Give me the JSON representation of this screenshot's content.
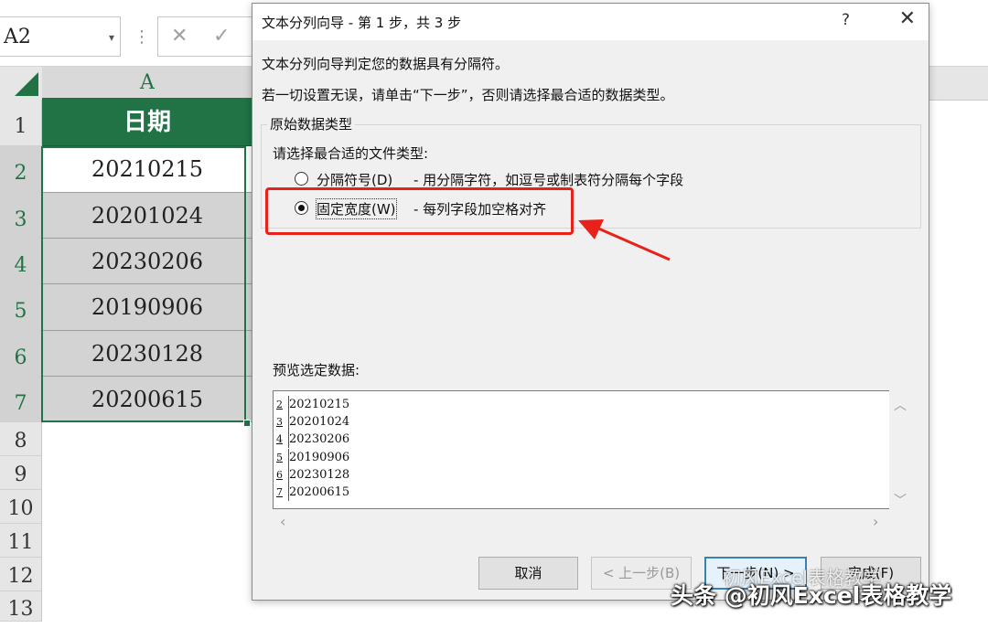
{
  "excel": {
    "name_box": "A2",
    "name_box_caret": "▾",
    "fb_separator": "⋮",
    "cancel_glyph": "✕",
    "enter_glyph": "✓",
    "column_header": "A",
    "header_cell": "日期",
    "cells": [
      "20210215",
      "20201024",
      "20230206",
      "20190906",
      "20230128",
      "20200615"
    ],
    "row_numbers": [
      "1",
      "2",
      "3",
      "4",
      "5",
      "6",
      "7",
      "8",
      "9",
      "10",
      "11",
      "12",
      "13"
    ]
  },
  "dialog": {
    "title": "文本分列向导 - 第 1 步，共 3 步",
    "help": "?",
    "close": "✕",
    "desc1": "文本分列向导判定您的数据具有分隔符。",
    "desc2": "若一切设置无误，请单击“下一步”，否则请选择最合适的数据类型。",
    "group_label": "原始数据类型",
    "choose_label": "请选择最合适的文件类型:",
    "option_delimited": {
      "label": "分隔符号(D)",
      "desc": "- 用分隔字符，如逗号或制表符分隔每个字段",
      "checked": false
    },
    "option_fixed": {
      "label": "固定宽度(W)",
      "desc": "- 每列字段加空格对齐",
      "checked": true
    },
    "preview_label": "预览选定数据:",
    "preview_lines": [
      {
        "num": "2",
        "text": "20210215"
      },
      {
        "num": "3",
        "text": "20201024"
      },
      {
        "num": "4",
        "text": "20230206"
      },
      {
        "num": "5",
        "text": "20190906"
      },
      {
        "num": "6",
        "text": "20230128"
      },
      {
        "num": "7",
        "text": "20200615"
      }
    ],
    "scroll_up": "︿",
    "scroll_down": "﹀",
    "scroll_left": "‹",
    "scroll_right": "›",
    "buttons": {
      "cancel": "取消",
      "back": "< 上一步(B)",
      "next": "下一步(N) >",
      "finish": "完成(F)"
    }
  },
  "watermark": {
    "main": "头条 @初风Excel表格教学",
    "faint": "初风Excel表格教学"
  },
  "colors": {
    "excel_green": "#217346",
    "highlight_red": "#e8221b"
  }
}
